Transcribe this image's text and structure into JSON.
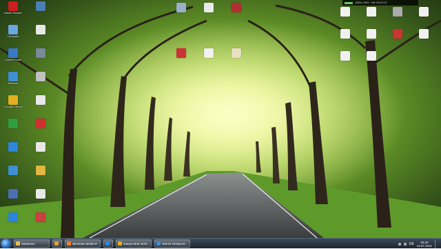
{
  "desktop": {
    "wallpaper": "tree-lined road with green foliage",
    "left_icons": [
      {
        "name": "adobe-reader-icon",
        "color": "#cc1f1f",
        "label": "Adobe Reader"
      },
      {
        "name": "app-icon",
        "color": "#4a7fb5",
        "label": ""
      },
      {
        "name": "computer-icon",
        "color": "#6aa7e0",
        "label": "Computer"
      },
      {
        "name": "document-icon",
        "color": "#e8e8e8",
        "label": ""
      },
      {
        "name": "control-panel-icon",
        "color": "#3a79c8",
        "label": "Control Panel"
      },
      {
        "name": "app-icon",
        "color": "#7a8a9a",
        "label": ""
      },
      {
        "name": "network-icon",
        "color": "#3e8fd4",
        "label": "Network"
      },
      {
        "name": "settings-icon",
        "color": "#c0c0c0",
        "label": ""
      },
      {
        "name": "chrome-icon",
        "color": "#e0b020",
        "label": "Google Chrome"
      },
      {
        "name": "document-icon",
        "color": "#e8e8e8",
        "label": ""
      },
      {
        "name": "app-icon",
        "color": "#2f9f3f",
        "label": ""
      },
      {
        "name": "app-icon",
        "color": "#d03030",
        "label": ""
      },
      {
        "name": "ie-icon",
        "color": "#2e86d8",
        "label": ""
      },
      {
        "name": "document-icon",
        "color": "#e8e8e8",
        "label": ""
      },
      {
        "name": "network-icon",
        "color": "#3e8fd4",
        "label": ""
      },
      {
        "name": "folder-icon",
        "color": "#e2b640",
        "label": ""
      },
      {
        "name": "app-icon",
        "color": "#4a6fb5",
        "label": ""
      },
      {
        "name": "document-icon",
        "color": "#e8e8e8",
        "label": ""
      },
      {
        "name": "ie-icon",
        "color": "#2e86d8",
        "label": ""
      },
      {
        "name": "app-icon",
        "color": "#c84040",
        "label": ""
      }
    ],
    "top_icons": [
      {
        "name": "app-icon",
        "color": "#9bb0c8",
        "label": ""
      },
      {
        "name": "document-icon",
        "color": "#e8e8e8",
        "label": ""
      },
      {
        "name": "app-icon",
        "color": "#b03030",
        "label": ""
      },
      {
        "name": "flag-icon",
        "color": "#c33",
        "label": ""
      },
      {
        "name": "document-icon",
        "color": "#f0f0f0",
        "label": ""
      },
      {
        "name": "document-icon",
        "color": "#e8e0c0",
        "label": ""
      }
    ],
    "right_icons": [
      {
        "name": "document-icon",
        "color": "#f0f0f0",
        "label": ""
      },
      {
        "name": "document-icon",
        "color": "#f0f0f0",
        "label": ""
      },
      {
        "name": "app-icon",
        "color": "#aaaaaa",
        "label": ""
      },
      {
        "name": "document-icon",
        "color": "#f0f0f0",
        "label": ""
      },
      {
        "name": "document-icon",
        "color": "#f0f0f0",
        "label": ""
      },
      {
        "name": "document-icon",
        "color": "#f0f0f0",
        "label": ""
      },
      {
        "name": "flag-icon",
        "color": "#c33",
        "label": ""
      },
      {
        "name": "document-icon",
        "color": "#f0f0f0",
        "label": ""
      },
      {
        "name": "document-icon",
        "color": "#f0f0f0",
        "label": ""
      },
      {
        "name": "document-icon",
        "color": "#f0f0f0",
        "label": ""
      }
    ]
  },
  "meter": {
    "text": "1150x 1920  ·  Hit: 09:27:07"
  },
  "taskbar": {
    "items": [
      {
        "label": "Sasticavo",
        "icon_color": "#e8c050"
      },
      {
        "label": "",
        "icon_color": "#e0a030"
      },
      {
        "label": "Windows Media P...",
        "icon_color": "#f08020"
      },
      {
        "label": "",
        "icon_color": "#2e86d8"
      },
      {
        "label": "Gaeya Mod Versi...",
        "icon_color": "#e0b020"
      },
      {
        "label": "Tait for Geriya M...",
        "icon_color": "#3a8fd0"
      }
    ],
    "lang": "DE",
    "time": "20:20",
    "date": "13.07.2011"
  }
}
